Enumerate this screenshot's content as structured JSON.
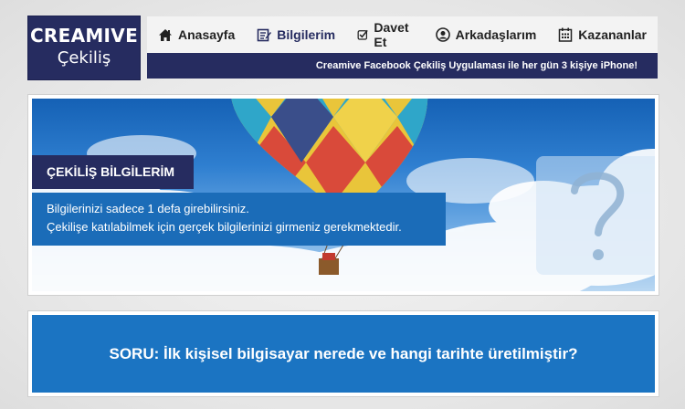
{
  "logo": {
    "line1": "CREAMIVE",
    "line2": "Çekiliş"
  },
  "nav": {
    "items": [
      {
        "label": "Anasayfa",
        "icon": "home-icon"
      },
      {
        "label": "Bilgilerim",
        "icon": "edit-icon"
      },
      {
        "label": "Davet Et",
        "icon": "checkbox-icon"
      },
      {
        "label": "Arkadaşlarım",
        "icon": "user-icon"
      },
      {
        "label": "Kazananlar",
        "icon": "calendar-icon"
      }
    ],
    "active": "Bilgilerim"
  },
  "ticker": {
    "text": "Creamive Facebook Çekiliş Uygulaması ile her gün 3 kişiye iPhone!"
  },
  "hero": {
    "title": "ÇEKİLİŞ BİLGİLERİM",
    "info_line1": "Bilgilerinizi sadece 1 defa girebilirsiniz.",
    "info_line2": "Çekilişe katılabilmek için gerçek bilgilerinizi girmeniz gerekmektedir."
  },
  "question": {
    "text": "SORU: İlk kişisel bilgisayar nerede ve hangi tarihte üretilmiştir?"
  },
  "colors": {
    "navy": "#262c60",
    "blue": "#1b74c2",
    "ticker_bg": "#262c60"
  }
}
